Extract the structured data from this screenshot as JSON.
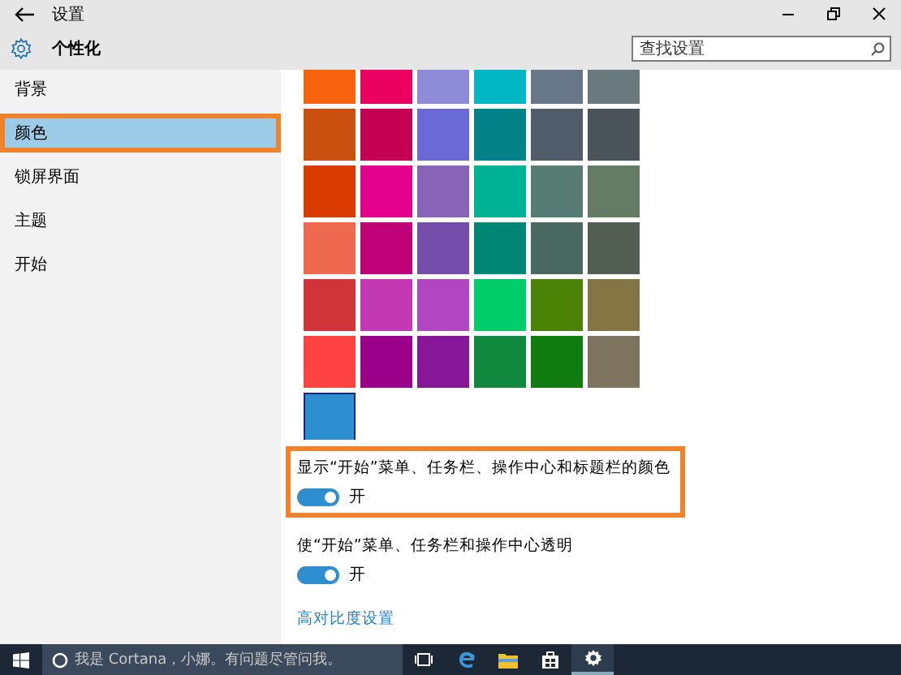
{
  "window": {
    "title": "设置"
  },
  "header": {
    "title": "个性化",
    "search": {
      "placeholder": "查找设置"
    }
  },
  "sidebar": {
    "items": [
      {
        "label": "背景",
        "selected": false,
        "highlighted": false
      },
      {
        "label": "颜色",
        "selected": true,
        "highlighted": true
      },
      {
        "label": "锁屏界面",
        "selected": false,
        "highlighted": false
      },
      {
        "label": "主题",
        "selected": false,
        "highlighted": false
      },
      {
        "label": "开始",
        "selected": false,
        "highlighted": false
      }
    ]
  },
  "swatches": [
    {
      "color": "#f7630c",
      "selected": false
    },
    {
      "color": "#ea005e",
      "selected": false
    },
    {
      "color": "#8e8cd8",
      "selected": false
    },
    {
      "color": "#00b7c3",
      "selected": false
    },
    {
      "color": "#68768a",
      "selected": false
    },
    {
      "color": "#69797e",
      "selected": false
    },
    {
      "color": "#ca5010",
      "selected": false
    },
    {
      "color": "#c30052",
      "selected": false
    },
    {
      "color": "#6b69d6",
      "selected": false
    },
    {
      "color": "#038387",
      "selected": false
    },
    {
      "color": "#515c6b",
      "selected": false
    },
    {
      "color": "#4a5459",
      "selected": false
    },
    {
      "color": "#da3b01",
      "selected": false
    },
    {
      "color": "#e3008c",
      "selected": false
    },
    {
      "color": "#8764b8",
      "selected": false
    },
    {
      "color": "#00b294",
      "selected": false
    },
    {
      "color": "#567c73",
      "selected": false
    },
    {
      "color": "#647c64",
      "selected": false
    },
    {
      "color": "#ef6950",
      "selected": false
    },
    {
      "color": "#bf0077",
      "selected": false
    },
    {
      "color": "#744da9",
      "selected": false
    },
    {
      "color": "#018574",
      "selected": false
    },
    {
      "color": "#486860",
      "selected": false
    },
    {
      "color": "#525e54",
      "selected": false
    },
    {
      "color": "#d13438",
      "selected": false
    },
    {
      "color": "#c239b3",
      "selected": false
    },
    {
      "color": "#b146c2",
      "selected": false
    },
    {
      "color": "#00cc6a",
      "selected": false
    },
    {
      "color": "#498205",
      "selected": false
    },
    {
      "color": "#847545",
      "selected": false
    },
    {
      "color": "#ff4343",
      "selected": false
    },
    {
      "color": "#9a0089",
      "selected": false
    },
    {
      "color": "#881798",
      "selected": false
    },
    {
      "color": "#10893e",
      "selected": false
    },
    {
      "color": "#107c10",
      "selected": false
    },
    {
      "color": "#7e735f",
      "selected": false
    },
    {
      "color": "#2d8fd0",
      "selected": true
    }
  ],
  "settings": [
    {
      "label": "显示“开始”菜单、任务栏、操作中心和标题栏的颜色",
      "on": true,
      "state": "开",
      "highlighted": true
    },
    {
      "label": "使“开始”菜单、任务栏和操作中心透明",
      "on": true,
      "state": "开",
      "highlighted": false
    }
  ],
  "link": "高对比度设置",
  "taskbar": {
    "search": {
      "placeholder": "我是 Cortana，小娜。有问题尽管问我。"
    }
  }
}
